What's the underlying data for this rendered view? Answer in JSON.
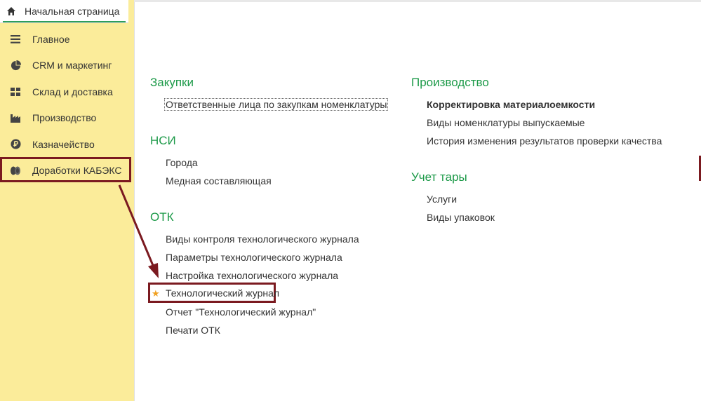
{
  "home_tab": {
    "label": "Начальная страница",
    "icon": "home-icon"
  },
  "sidebar": {
    "items": [
      {
        "label": "Главное",
        "icon": "menu-lines-icon"
      },
      {
        "label": "CRM и маркетинг",
        "icon": "pie-chart-icon"
      },
      {
        "label": "Склад и доставка",
        "icon": "warehouse-grid-icon"
      },
      {
        "label": "Производство",
        "icon": "factory-icon"
      },
      {
        "label": "Казначейство",
        "icon": "ruble-coin-icon"
      },
      {
        "label": "Доработки КАБЭКС",
        "icon": "coins-icon",
        "highlighted": true
      }
    ]
  },
  "groups": {
    "zakupki": {
      "title": "Закупки",
      "links": [
        "Ответственные лица по закупкам номенклатуры"
      ]
    },
    "nsi": {
      "title": "НСИ",
      "links": [
        "Города",
        "Медная составляющая"
      ]
    },
    "otk": {
      "title": "ОТК",
      "links": [
        "Виды контроля технологического журнала",
        "Параметры технологического журнала",
        "Настройка технологического журнала",
        "Технологический журнал",
        "Отчет \"Технологический журнал\"",
        "Печати ОТК"
      ]
    },
    "proizvodstvo": {
      "title": "Производство",
      "links": [
        "Корректировка материалоемкости",
        "Виды номенклатуры выпускаемые",
        "История изменения результатов проверки качества"
      ]
    },
    "uchet_tary": {
      "title": "Учет тары",
      "links": [
        "Услуги",
        "Виды упаковок"
      ]
    }
  },
  "colors": {
    "sidebar_bg": "#fbec9a",
    "group_title": "#1d9a49",
    "highlight": "#7b1a20",
    "star": "#f0a020"
  }
}
